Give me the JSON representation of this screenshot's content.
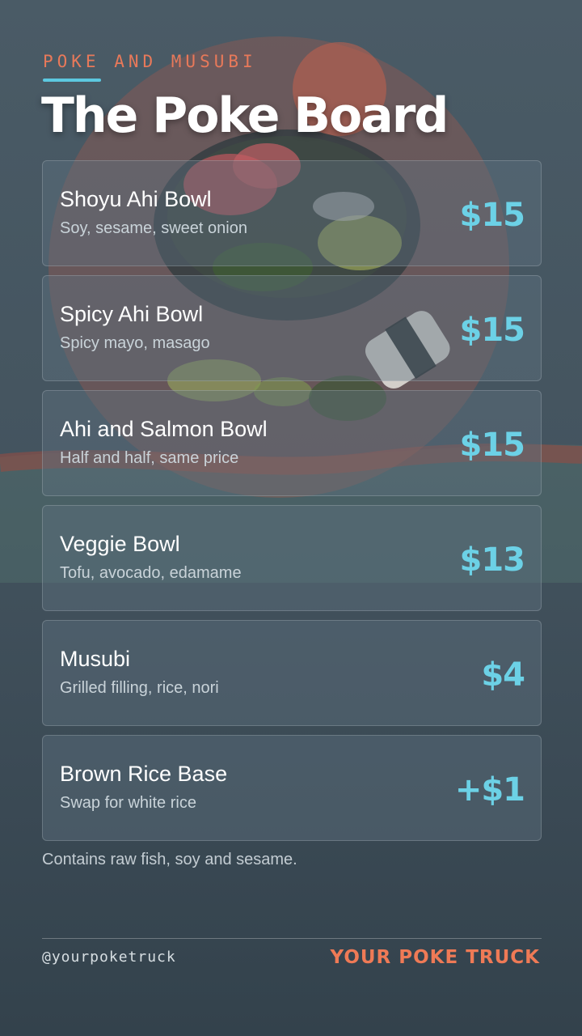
{
  "header": {
    "eyebrow": "POKE AND MUSUBI",
    "title": "The Poke Board"
  },
  "menu": {
    "items": [
      {
        "name": "Shoyu Ahi Bowl",
        "description": "Soy, sesame, sweet onion",
        "price": "$15"
      },
      {
        "name": "Spicy Ahi Bowl",
        "description": "Spicy mayo, masago",
        "price": "$15"
      },
      {
        "name": "Ahi and Salmon Bowl",
        "description": "Half and half, same price",
        "price": "$15"
      },
      {
        "name": "Veggie Bowl",
        "description": "Tofu, avocado, edamame",
        "price": "$13"
      },
      {
        "name": "Musubi",
        "description": "Grilled filling, rice, nori",
        "price": "$4"
      },
      {
        "name": "Brown Rice Base",
        "description": "Swap for white rice",
        "price": "+$1"
      }
    ]
  },
  "allergen_note": "Contains raw fish, soy and sesame.",
  "footer": {
    "handle": "@yourpoketruck",
    "brand": "YOUR POKE TRUCK"
  },
  "colors": {
    "accent_coral": "#e8795a",
    "accent_cyan": "#6cd1e6",
    "background": "#44545f"
  }
}
